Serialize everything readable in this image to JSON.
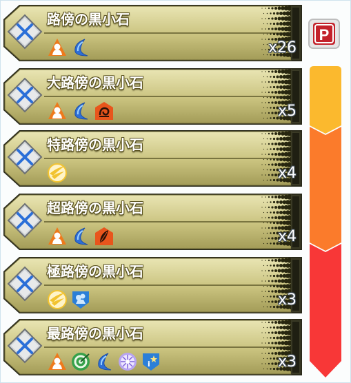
{
  "pickup_button": {
    "label": "P",
    "color": "#c3222b"
  },
  "rank_bar": {
    "colors": [
      "#fbb92e",
      "#fb7b2b",
      "#f83737"
    ]
  },
  "stones": [
    {
      "name": "路傍の黒小石",
      "count": "x26",
      "icons": [
        "tank-role-icon",
        "crescent-icon"
      ]
    },
    {
      "name": "大路傍の黒小石",
      "count": "x5",
      "icons": [
        "tank-role-icon",
        "crescent-icon",
        "snail-shield-icon"
      ]
    },
    {
      "name": "特路傍の黒小石",
      "count": "x4",
      "icons": [
        "wind-slash-icon"
      ]
    },
    {
      "name": "超路傍の黒小石",
      "count": "x4",
      "icons": [
        "tank-role-icon",
        "crescent-icon",
        "feather-shield-icon"
      ]
    },
    {
      "name": "極路傍の黒小石",
      "count": "x3",
      "icons": [
        "wind-slash-icon",
        "blue-shield-icon"
      ]
    },
    {
      "name": "最路傍の黒小石",
      "count": "x3",
      "icons": [
        "tank-role-icon",
        "target-icon",
        "crescent-icon",
        "burst-icon",
        "star-shield-icon"
      ]
    }
  ]
}
